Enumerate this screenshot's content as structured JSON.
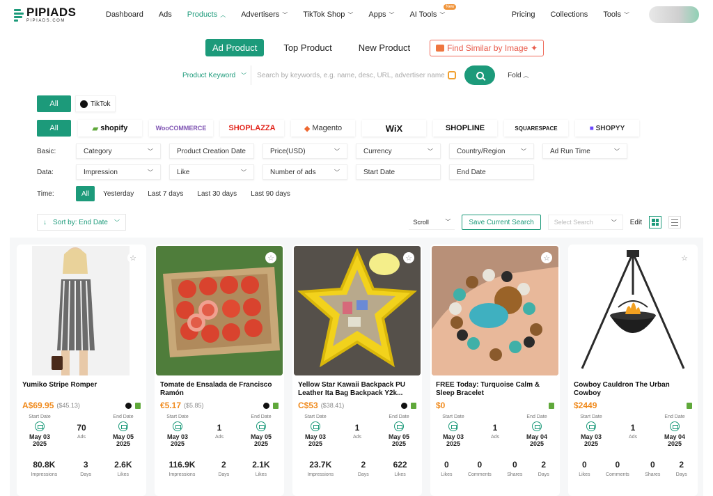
{
  "brand": {
    "name": "PIPIADS",
    "domain": "PIPIADS.COM",
    "color": "#1c9a7a"
  },
  "nav": {
    "items": [
      "Dashboard",
      "Ads",
      "Products",
      "Advertisers",
      "TikTok Shop",
      "Apps",
      "AI Tools"
    ],
    "active": "Products",
    "new_badge": "New",
    "right": [
      "Pricing",
      "Collections",
      "Tools"
    ]
  },
  "tabs": {
    "items": [
      "Ad Product",
      "Top Product",
      "New Product"
    ],
    "active": "Ad Product",
    "find_similar": "Find Similar by Image"
  },
  "search": {
    "type": "Product Keyword",
    "placeholder": "Search by keywords, e.g. name, desc, URL, advertiser name",
    "fold": "Fold"
  },
  "platform": {
    "all": "All",
    "tiktok": "TikTok"
  },
  "stores": {
    "all": "All",
    "items": [
      "shopify",
      "WooCOMMERCE",
      "SHOPLAZZA",
      "Magento",
      "WiX",
      "SHOPLINE",
      "SQUARESPACE",
      "SHOPYY"
    ]
  },
  "filters": {
    "basic_label": "Basic:",
    "basic": [
      "Category",
      "Product Creation Date",
      "Price(USD)",
      "Currency",
      "Country/Region",
      "Ad Run Time"
    ],
    "data_label": "Data:",
    "data": [
      "Impression",
      "Like",
      "Number of ads",
      "Start Date",
      "End Date"
    ],
    "time_label": "Time:",
    "time": [
      "All",
      "Yesterday",
      "Last 7 days",
      "Last 30 days",
      "Last 90 days"
    ]
  },
  "sort": {
    "label": "Sort by: End Date",
    "scroll": "Scroll",
    "save": "Save Current Search",
    "select_search": "Select Search",
    "edit": "Edit"
  },
  "labels": {
    "start": "Start Date",
    "end": "End Date",
    "ads": "Ads"
  },
  "products": [
    {
      "title": "Yumiko Stripe Romper",
      "price": "A$69.95",
      "orig": "($45.13)",
      "start": "May 03 2025",
      "end": "May 05 2025",
      "ads": "70",
      "stats": [
        {
          "v": "80.8K",
          "l": "Impressions"
        },
        {
          "v": "3",
          "l": "Days"
        },
        {
          "v": "2.6K",
          "l": "Likes"
        }
      ],
      "tk": true
    },
    {
      "title": "Tomate de Ensalada de Francisco Ramón",
      "price": "€5.17",
      "orig": "($5.85)",
      "start": "May 03 2025",
      "end": "May 05 2025",
      "ads": "1",
      "stats": [
        {
          "v": "116.9K",
          "l": "Impressions"
        },
        {
          "v": "2",
          "l": "Days"
        },
        {
          "v": "2.1K",
          "l": "Likes"
        }
      ],
      "tk": true
    },
    {
      "title": "Yellow Star Kawaii Backpack PU Leather Ita Bag Backpack Y2k...",
      "price": "C$53",
      "orig": "($38.41)",
      "start": "May 03 2025",
      "end": "May 05 2025",
      "ads": "1",
      "stats": [
        {
          "v": "23.7K",
          "l": "Impressions"
        },
        {
          "v": "2",
          "l": "Days"
        },
        {
          "v": "622",
          "l": "Likes"
        }
      ],
      "tk": true
    },
    {
      "title": "FREE Today: Turquoise Calm & Sleep Bracelet",
      "price": "$0",
      "orig": "",
      "start": "May 03 2025",
      "end": "May 04 2025",
      "ads": "1",
      "stats": [
        {
          "v": "0",
          "l": "Likes"
        },
        {
          "v": "0",
          "l": "Comments"
        },
        {
          "v": "0",
          "l": "Shares"
        },
        {
          "v": "2",
          "l": "Days"
        }
      ],
      "tk": false
    },
    {
      "title": "Cowboy Cauldron The Urban Cowboy",
      "price": "$2449",
      "orig": "",
      "start": "May 03 2025",
      "end": "May 04 2025",
      "ads": "1",
      "stats": [
        {
          "v": "0",
          "l": "Likes"
        },
        {
          "v": "0",
          "l": "Comments"
        },
        {
          "v": "0",
          "l": "Shares"
        },
        {
          "v": "2",
          "l": "Days"
        }
      ],
      "tk": false
    }
  ]
}
